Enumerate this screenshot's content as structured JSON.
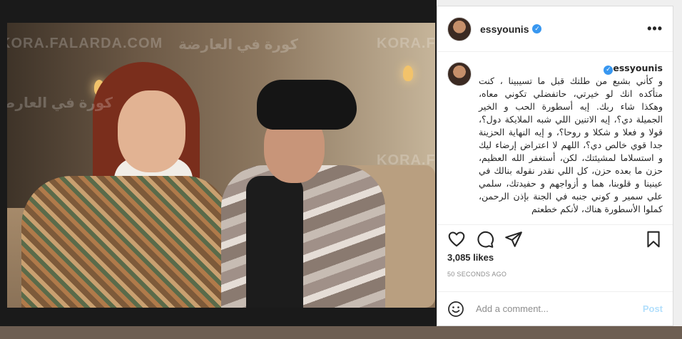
{
  "photo": {
    "watermarks": [
      "KORA.FALARDA.COM",
      "كورة في العارضة",
      "KORA.FALARDA.COM",
      "كورة في العارضة",
      "KORA.FALARDA.COM"
    ]
  },
  "post": {
    "username": "essyounis",
    "verified_symbol": "✓",
    "more_symbol": "•••",
    "caption": "و كأني بشبع من طلتك قبل ما تسيبينا ، كنت متأكده انك لو خيرتي، حاتفضلي تكوني معاه، وهكذا شاء ربك. إيه أسطورة الحب و الخير الجميلة دي؟، إيه الاتنين اللي شبه الملايكة دول؟، قولا و فعلا و شكلا و روحا؟، و إيه النهاية الحزينة جدا قوي خالص دي؟، اللهم لا اعتراض إرضاء ليك و استسلاما لمشيئتك، لكن، أستغفر الله العظيم، حزن ما بعده حزن، كل اللي نقدر نقوله بنالك في عينينا و قلوبنا، هما و أزواجهم و حفيدتك، سلمي علي سمير و كوني جنبه في الجنة بإذن الرحمن، كملوا الأسطورة هناك، لأنكم خطعتم",
    "likes": "3,085 likes",
    "time_ago": "50 SECONDS AGO",
    "comment_placeholder": "Add a comment...",
    "post_button": "Post"
  },
  "icons": {
    "like": "heart-icon",
    "comment": "comment-icon",
    "share": "paper-plane-icon",
    "save": "bookmark-icon",
    "emoji": "smiley-icon",
    "more": "ellipsis-icon"
  },
  "colors": {
    "verified": "#3897f0",
    "post_disabled": "#b2dffc",
    "text": "#262626",
    "muted": "#8e8e8e"
  }
}
